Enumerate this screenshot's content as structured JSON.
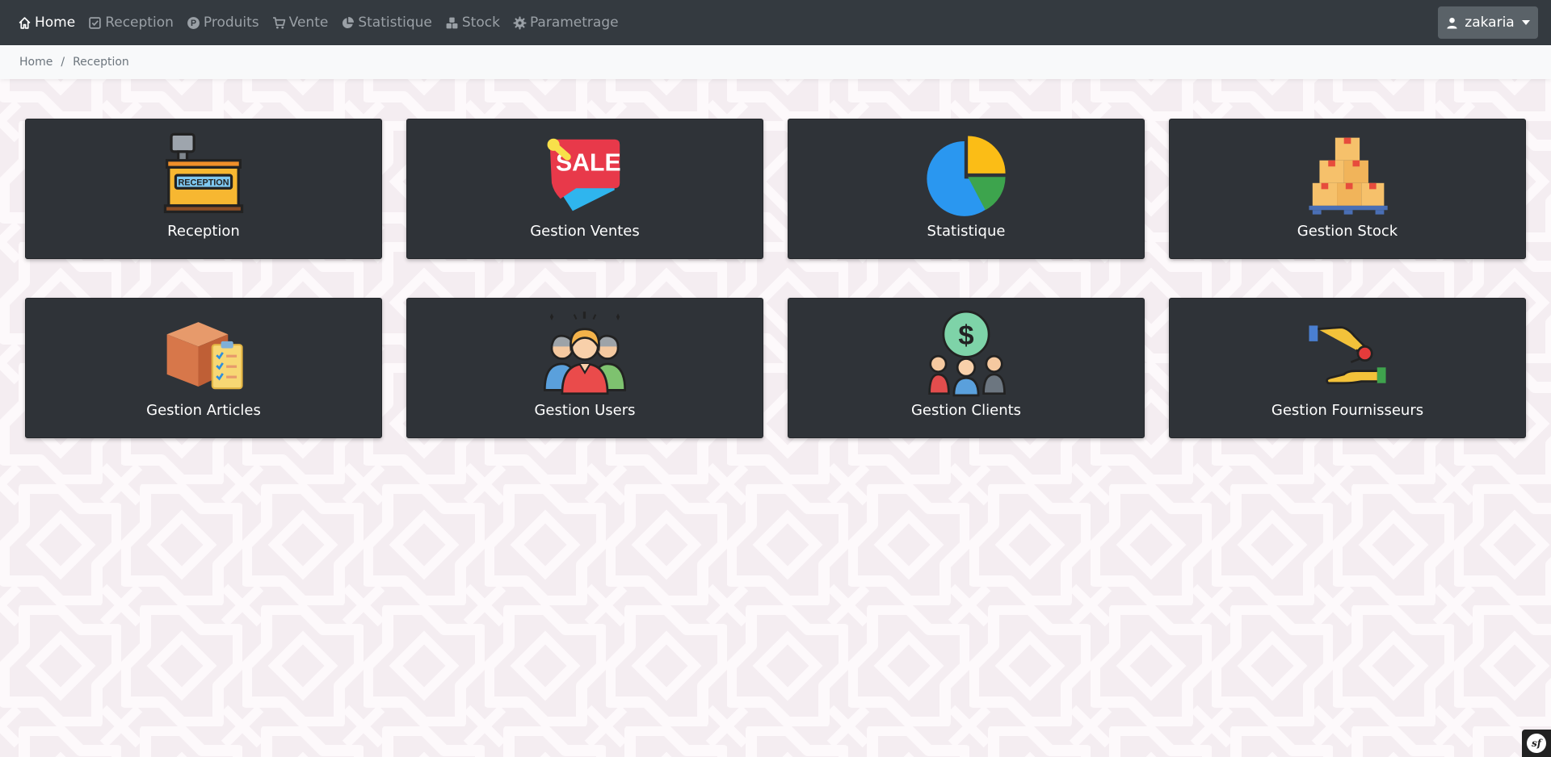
{
  "nav": {
    "items": [
      {
        "label": "Home",
        "icon": "home-icon",
        "active": true
      },
      {
        "label": "Reception",
        "icon": "checkbox-icon",
        "active": false
      },
      {
        "label": "Produits",
        "icon": "p-circle-icon",
        "active": false
      },
      {
        "label": "Vente",
        "icon": "cart-icon",
        "active": false
      },
      {
        "label": "Statistique",
        "icon": "pie-chart-icon",
        "active": false
      },
      {
        "label": "Stock",
        "icon": "cubes-icon",
        "active": false
      },
      {
        "label": "Parametrage",
        "icon": "gear-icon",
        "active": false
      }
    ],
    "user": {
      "name": "zakaria",
      "icon": "user-icon"
    }
  },
  "breadcrumb": {
    "items": [
      "Home",
      "Reception"
    ],
    "separator": "/"
  },
  "tiles": [
    {
      "label": "Reception",
      "icon": "reception-desk-icon"
    },
    {
      "label": "Gestion Ventes",
      "icon": "sale-tag-icon"
    },
    {
      "label": "Statistique",
      "icon": "pie-chart-icon"
    },
    {
      "label": "Gestion Stock",
      "icon": "boxes-pallet-icon"
    },
    {
      "label": "Gestion Articles",
      "icon": "box-checklist-icon"
    },
    {
      "label": "Gestion Users",
      "icon": "users-group-icon"
    },
    {
      "label": "Gestion Clients",
      "icon": "clients-dollar-icon"
    },
    {
      "label": "Gestion Fournisseurs",
      "icon": "supplier-handshake-icon"
    }
  ],
  "colors": {
    "navbar_bg": "#343a40",
    "tile_bg": "#2f3338",
    "page_bg": "#f6f3f5",
    "user_button_bg": "#5a6268"
  },
  "debug_toolbar": {
    "icon": "symfony-icon",
    "logo_text": "sf"
  }
}
